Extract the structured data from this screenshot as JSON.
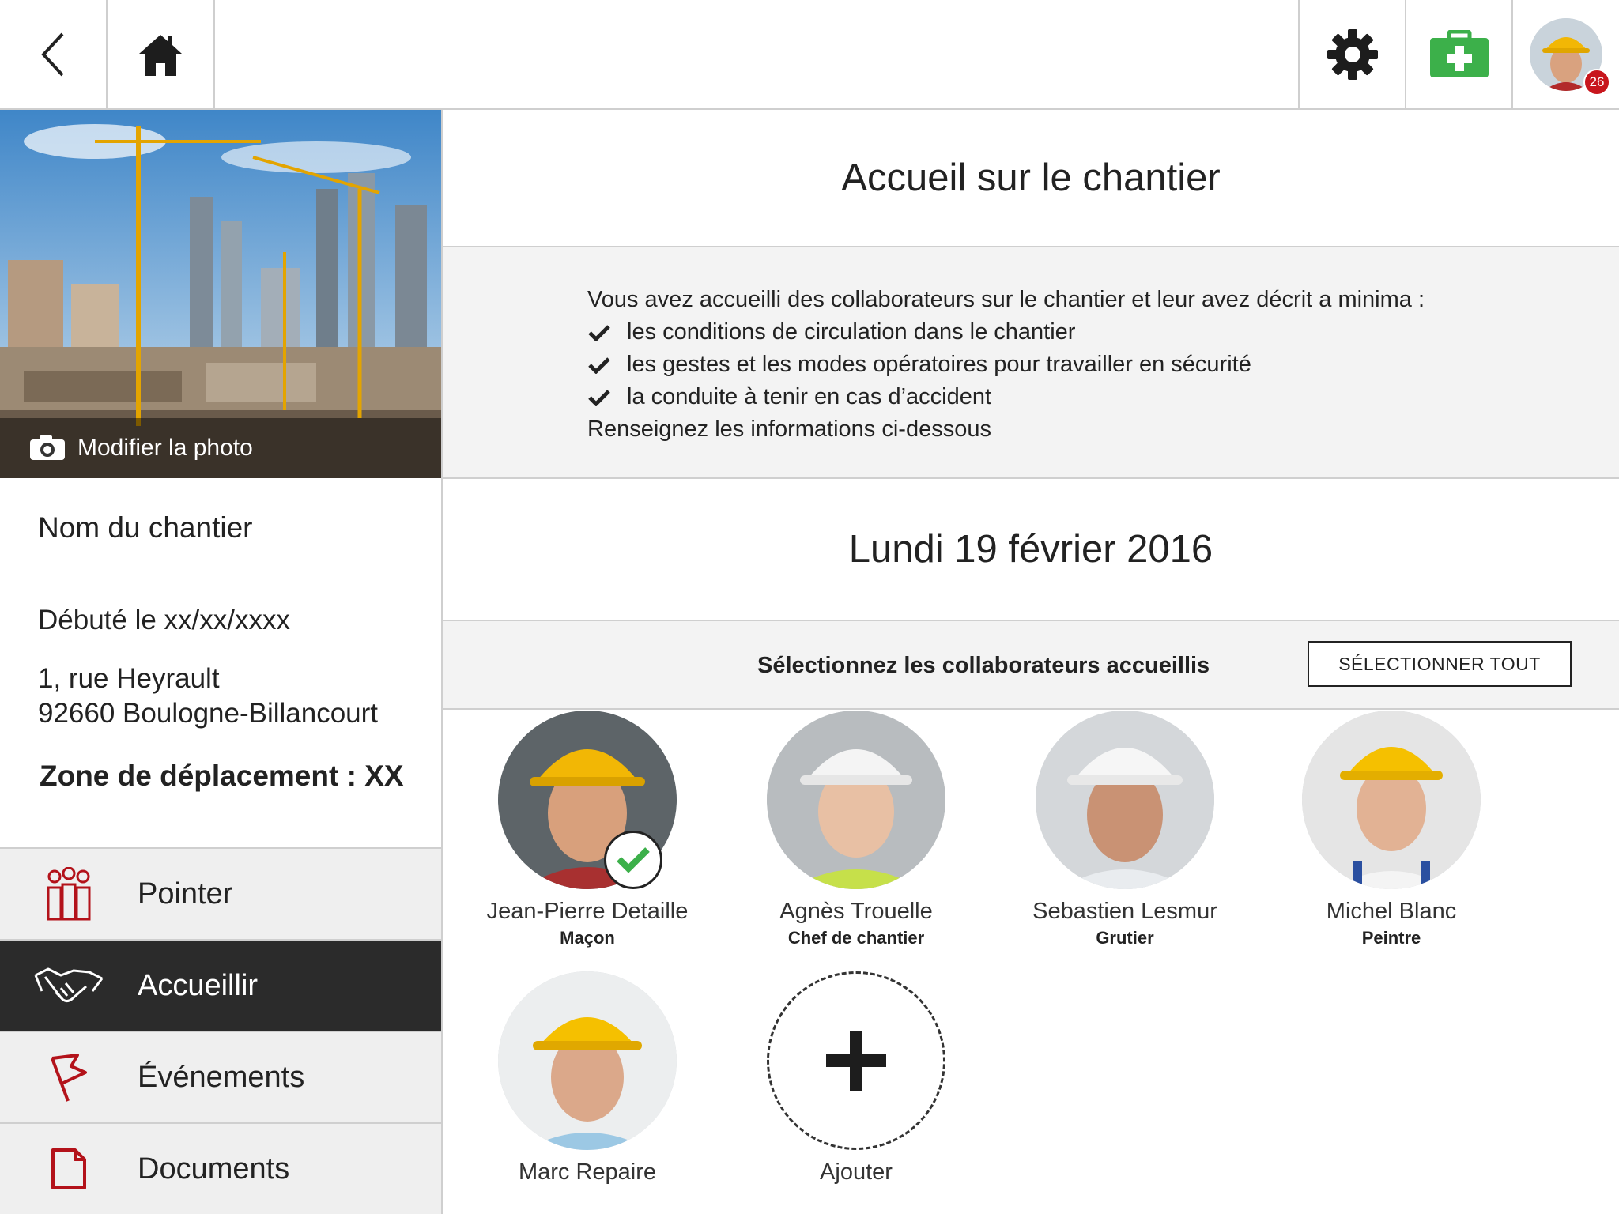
{
  "topbar": {
    "back_icon": "chevron-left-icon",
    "home_icon": "home-icon",
    "settings_icon": "gear-icon",
    "firstaid_icon": "first-aid-kit-icon",
    "notification_count": "26",
    "accent_green": "#3cb04a",
    "badge_red": "#c8161d"
  },
  "site": {
    "photo_action": "Modifier la photo",
    "name": "Nom du chantier",
    "start": "Débuté le xx/xx/xxxx",
    "address_line1": "1, rue Heyrault",
    "address_line2": "92660 Boulogne-Billancourt",
    "zone": "Zone de déplacement : XX"
  },
  "nav": [
    {
      "label": "Pointer",
      "icon": "team-clock-icon",
      "active": false
    },
    {
      "label": "Accueillir",
      "icon": "handshake-icon",
      "active": true
    },
    {
      "label": "Événements",
      "icon": "flag-icon",
      "active": false
    },
    {
      "label": "Documents",
      "icon": "document-icon",
      "active": false
    }
  ],
  "main": {
    "title": "Accueil sur le chantier",
    "notice_intro": "Vous avez accueilli des collaborateurs sur le chantier et leur avez décrit a minima :",
    "notice_items": [
      "les conditions de circulation dans le chantier",
      "les gestes et les modes opératoires pour travailler en sécurité",
      "la conduite à tenir en cas d’accident"
    ],
    "notice_outro": "Renseignez les informations ci-dessous",
    "date": "Lundi 19 février 2016",
    "select_label": "Sélectionnez les collaborateurs accueillis",
    "select_all": "SÉLECTIONNER TOUT",
    "add_label": "Ajouter"
  },
  "workers": [
    {
      "name": "Jean-Pierre Detaille",
      "role": "Maçon",
      "helmet": "#f2b705",
      "selected": true
    },
    {
      "name": "Agnès Trouelle",
      "role": "Chef de chantier",
      "helmet": "#f4f4f4",
      "selected": false
    },
    {
      "name": "Sebastien Lesmur",
      "role": "Grutier",
      "helmet": "#f4f4f4",
      "selected": false
    },
    {
      "name": "Michel Blanc",
      "role": "Peintre",
      "helmet": "#f5c000",
      "selected": false
    },
    {
      "name": "Marc Repaire",
      "role": "",
      "helmet": "#f5c000",
      "selected": false
    }
  ]
}
